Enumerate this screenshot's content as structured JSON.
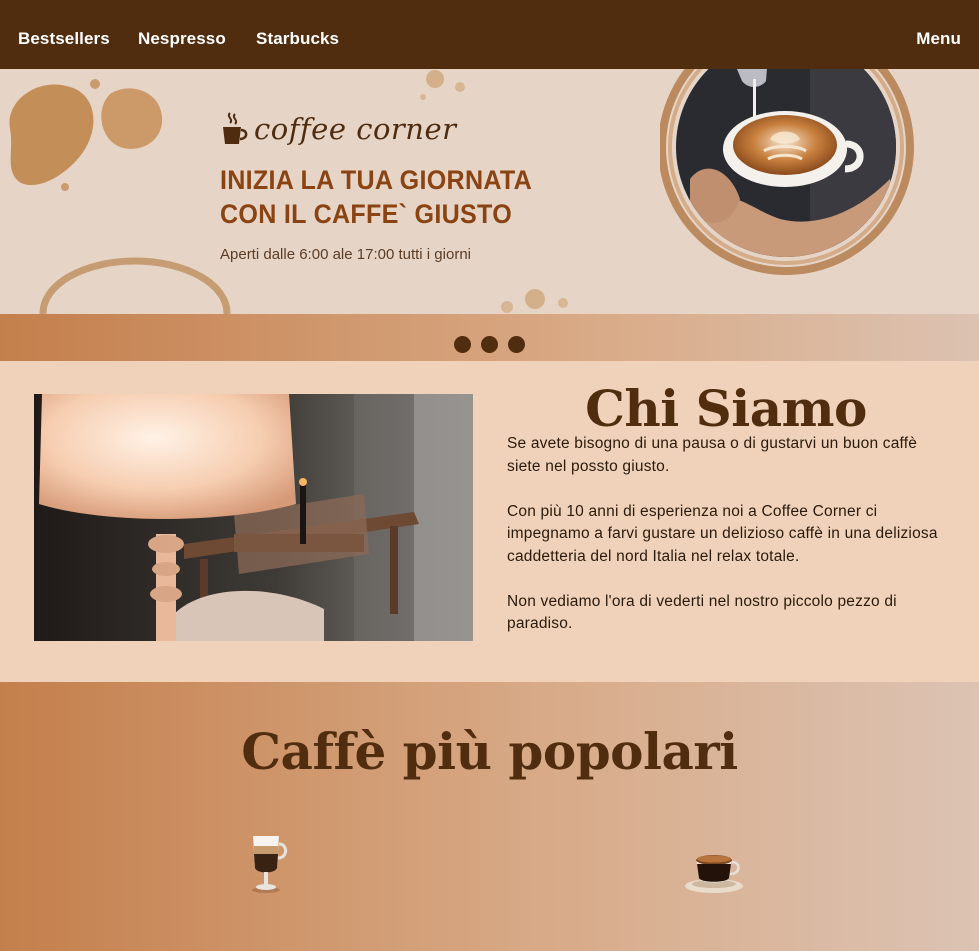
{
  "nav": {
    "items": [
      "Bestsellers",
      "Nespresso",
      "Starbucks"
    ],
    "menu_label": "Menu"
  },
  "hero": {
    "logo_text": "coffee corner",
    "headline_line1": "INIZIA LA TUA GIORNATA",
    "headline_line2": "CON IL CAFFE` GIUSTO",
    "hours": "Aperti dalle 6:00 ale 17:00 tutti i giorni"
  },
  "carousel": {
    "dots": 3
  },
  "about": {
    "title": "Chi Siamo",
    "paragraphs": [
      "Se avete bisogno di una pausa o di gustarvi un buon caffè siete nel possto giusto.",
      "Con più 10 anni di esperienza noi a Coffee Corner ci impegnamo a farvi gustare un delizioso caffè in una deliziosa caddetteria del nord Italia nel relax totale.",
      "Non vediamo l'ora di vederti nel nostro piccolo pezzo di paradiso."
    ]
  },
  "popular": {
    "title": "Caffè più popolari"
  },
  "colors": {
    "brown_dark": "#512d10",
    "headline": "#8a4312",
    "hero_bg": "#e6d5c7",
    "section_bg": "#efd2b9"
  }
}
